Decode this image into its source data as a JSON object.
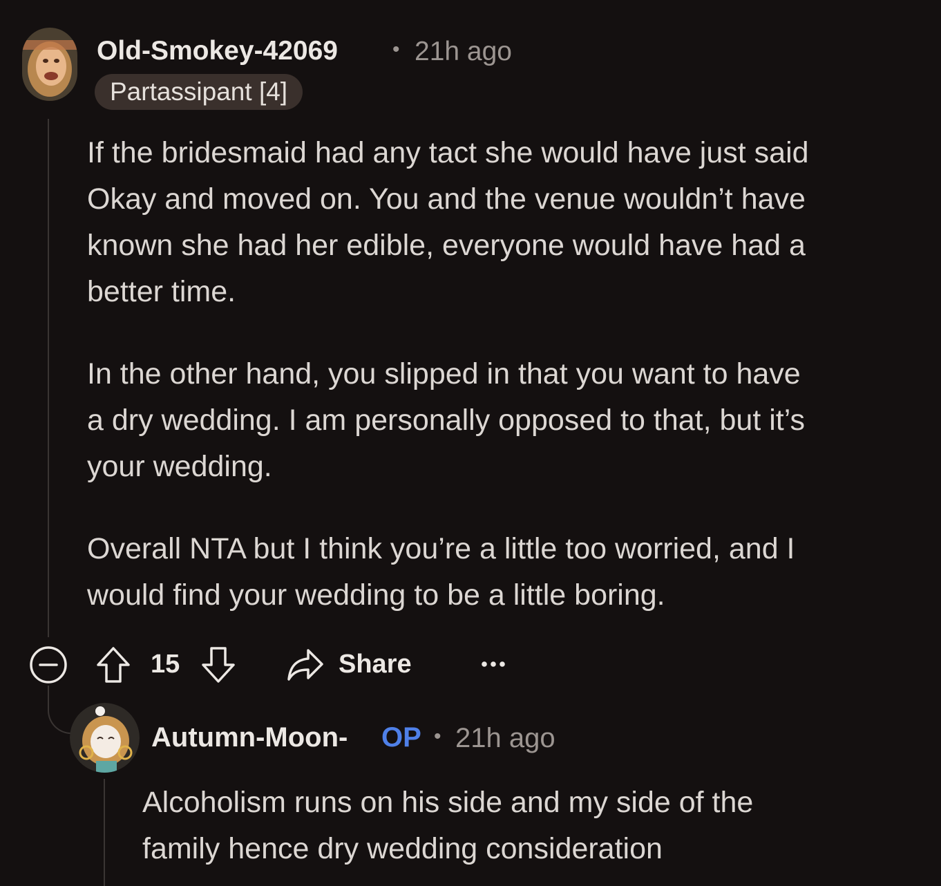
{
  "comment": {
    "author": "Old-Smokey-42069",
    "separator": "•",
    "time_ago": "21h ago",
    "flair": "Partassipant [4]",
    "paragraphs": [
      [
        "If the bridesmaid had any tact she would have just said",
        "Okay and moved on. You and the venue wouldn’t have",
        "known she had her edible, everyone would have had a",
        "better time."
      ],
      [
        "In the other hand, you slipped in that you want to have",
        "a dry wedding. I am personally opposed to that, but it’s",
        "your wedding."
      ],
      [
        "Overall NTA but I think you’re a little too worried, and I",
        "would find your wedding to be a little boring."
      ]
    ],
    "actions": {
      "collapse_icon": "collapse-minus-icon",
      "upvote_icon": "upvote-arrow-icon",
      "vote_count": "15",
      "downvote_icon": "downvote-arrow-icon",
      "share_icon": "share-arrow-icon",
      "share_label": "Share",
      "more_icon": "more-dots-icon"
    }
  },
  "reply": {
    "author": "Autumn-Moon-",
    "op_badge": "OP",
    "separator": "•",
    "time_ago": "21h ago",
    "lines": [
      "Alcoholism runs on his side and my side of the",
      "family hence dry wedding consideration"
    ]
  },
  "colors": {
    "background": "#141010",
    "text": "#dcd7d3",
    "meta": "#9c9591",
    "op_blue": "#4f80e8",
    "flair_bg": "#3a302c",
    "thread_line": "#3a3533"
  }
}
